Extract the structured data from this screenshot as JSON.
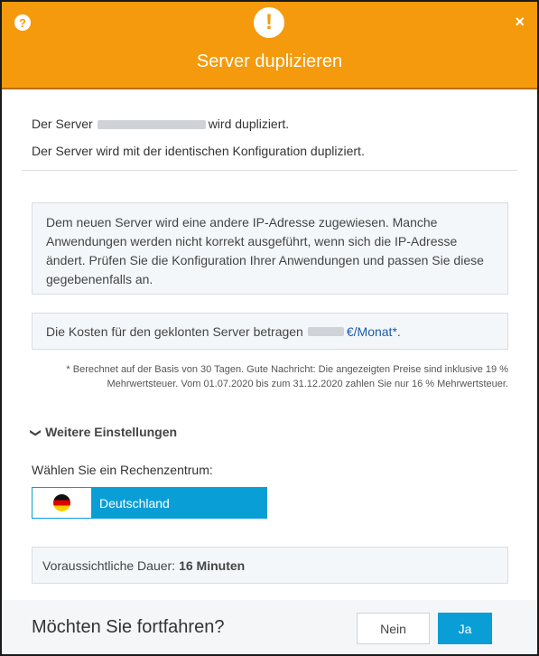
{
  "header": {
    "title": "Server duplizieren",
    "help_icon": "?",
    "close_icon": "×",
    "warning_icon": "!"
  },
  "body": {
    "line1_prefix": "Der Server",
    "line1_suffix": "wird dupliziert.",
    "line2": "Der Server wird mit der identischen Konfiguration dupliziert.",
    "info_text": "Dem neuen Server wird eine andere IP-Adresse zugewiesen. Manche Anwendungen werden nicht korrekt ausgeführt, wenn sich die IP-Adresse ändert. Prüfen Sie die Konfiguration Ihrer Anwendungen und passen Sie diese gegebenenfalls an.",
    "cost_prefix": "Die Kosten für den geklonten Server betragen",
    "cost_unit": "€/Monat*.",
    "footnote": "* Berechnet auf der Basis von 30 Tagen. Gute Nachricht: Die angezeigten Preise sind inklusive 19 % Mehrwertsteuer. Vom 01.07.2020 bis zum 31.12.2020 zahlen Sie nur 16 % Mehrwertsteuer.",
    "settings_toggle": "Weitere Einstellungen",
    "datacenter_label": "Wählen Sie ein Rechenzentrum:",
    "datacenter_selected": "Deutschland",
    "duration_label": "Voraussichtliche Dauer:",
    "duration_value": "16 Minuten"
  },
  "footer": {
    "question": "Möchten Sie fortfahren?",
    "no_label": "Nein",
    "yes_label": "Ja"
  },
  "colors": {
    "header": "#f59a0c",
    "accent": "#0a9ed6",
    "link": "#1b5ca8"
  },
  "icons": [
    "help-icon",
    "close-icon",
    "warning-icon",
    "chevron-down-icon",
    "germany-flag-icon"
  ]
}
